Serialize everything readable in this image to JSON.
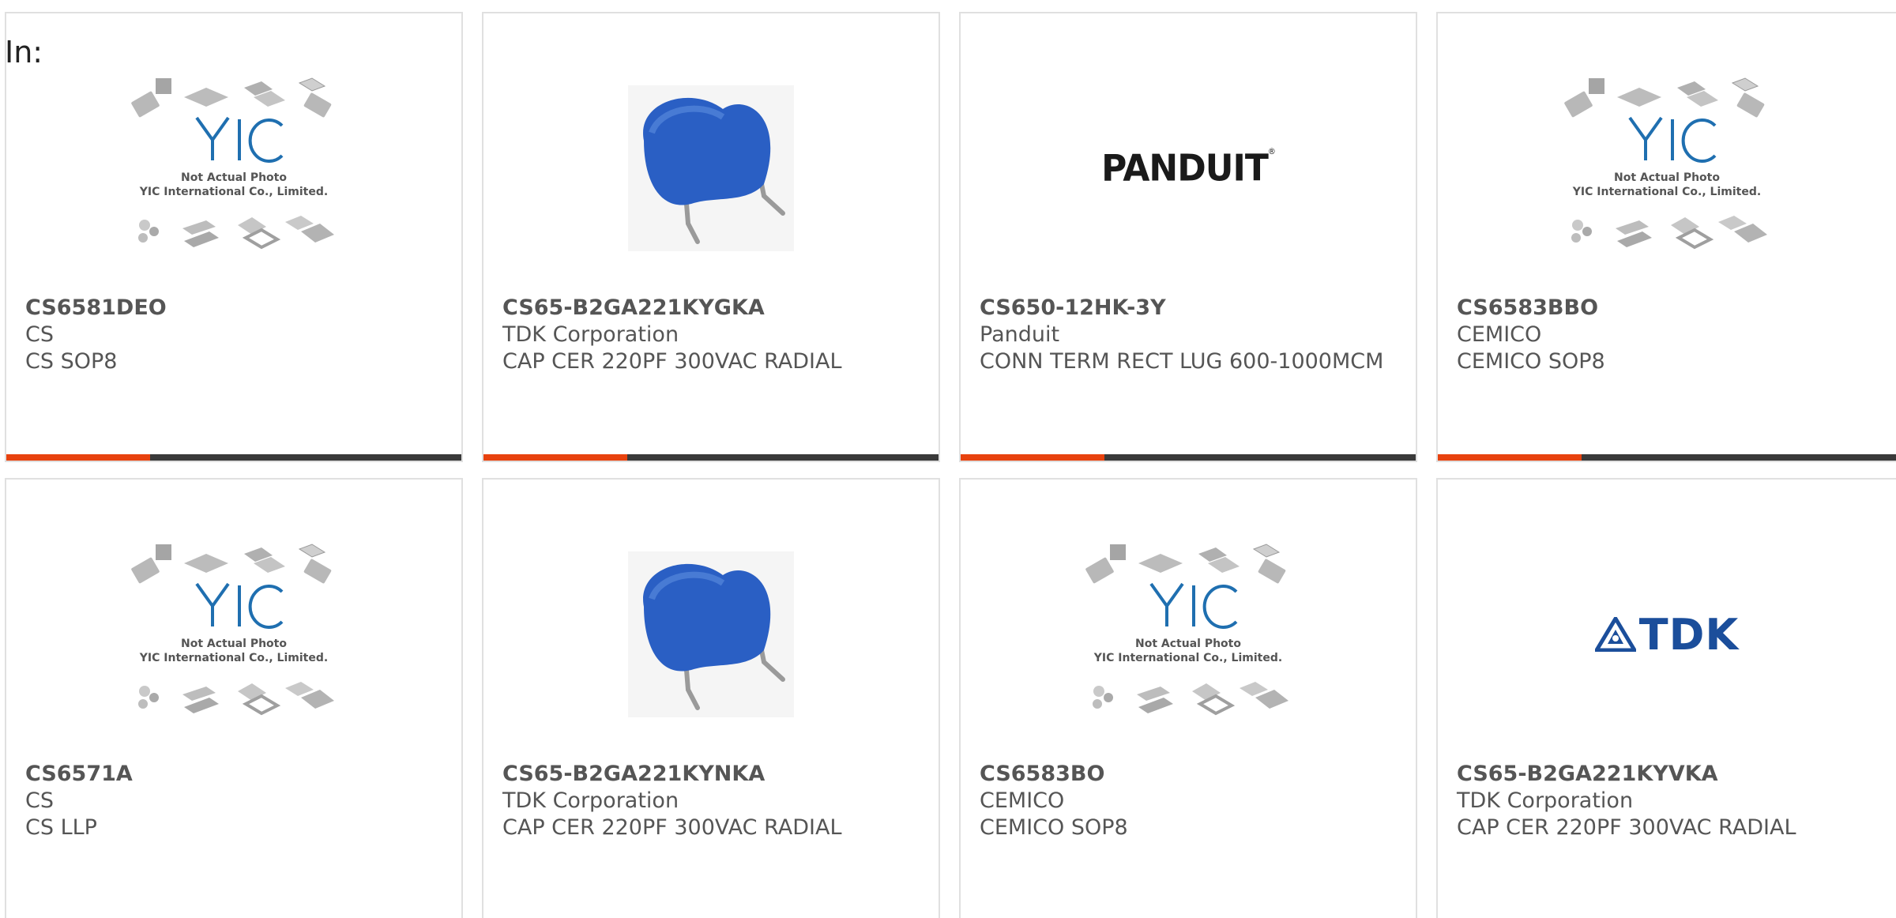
{
  "header": {
    "in_label": "In:"
  },
  "placeholder": {
    "line1": "Not Actual Photo",
    "line2": "YIC International Co., Limited.",
    "logo_text": "YIC"
  },
  "colors": {
    "accent": "#e8420e",
    "bar": "#3a3a3a",
    "yic_blue": "#1f6fb0",
    "tdk_blue": "#1b4e9b",
    "capacitor_blue": "#2a5fc4"
  },
  "cards": [
    {
      "part_number": "CS6581DEO",
      "manufacturer": "CS",
      "description": "CS SOP8",
      "image": "yic-placeholder"
    },
    {
      "part_number": "CS65-B2GA221KYGKA",
      "manufacturer": "TDK Corporation",
      "description": "CAP CER 220PF 300VAC RADIAL",
      "image": "capacitor-photo"
    },
    {
      "part_number": "CS650-12HK-3Y",
      "manufacturer": "Panduit",
      "description": "CONN TERM RECT LUG 600-1000MCM",
      "image": "panduit-logo",
      "logo_text": "PANDUIT",
      "logo_mark": "®"
    },
    {
      "part_number": "CS6583BBO",
      "manufacturer": "CEMICO",
      "description": "CEMICO SOP8",
      "image": "yic-placeholder"
    },
    {
      "part_number": "CS6571A",
      "manufacturer": "CS",
      "description": "CS LLP",
      "image": "yic-placeholder"
    },
    {
      "part_number": "CS65-B2GA221KYNKA",
      "manufacturer": "TDK Corporation",
      "description": "CAP CER 220PF 300VAC RADIAL",
      "image": "capacitor-photo"
    },
    {
      "part_number": "CS6583BO",
      "manufacturer": "CEMICO",
      "description": "CEMICO SOP8",
      "image": "yic-placeholder"
    },
    {
      "part_number": "CS65-B2GA221KYVKA",
      "manufacturer": "TDK Corporation",
      "description": "CAP CER 220PF 300VAC RADIAL",
      "image": "tdk-logo",
      "logo_text": "TDK"
    }
  ]
}
